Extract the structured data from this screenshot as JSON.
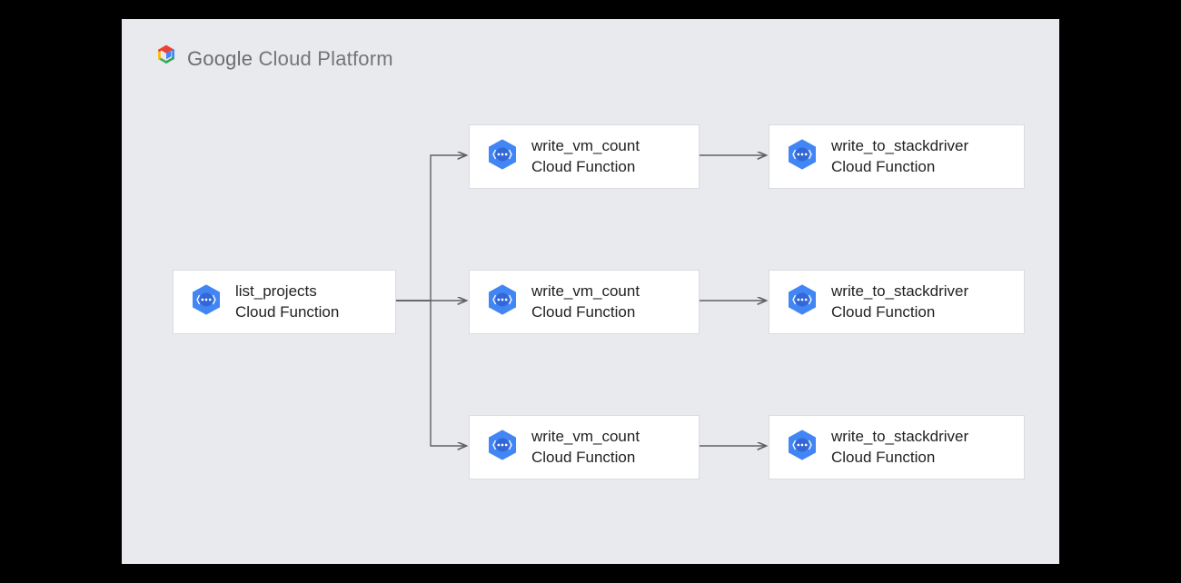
{
  "header": {
    "brand_bold": "Google",
    "brand_rest": "Cloud Platform"
  },
  "nodes": {
    "list_projects": {
      "title": "list_projects",
      "subtitle": "Cloud Function"
    },
    "write_vm_count_1": {
      "title": "write_vm_count",
      "subtitle": "Cloud Function"
    },
    "write_vm_count_2": {
      "title": "write_vm_count",
      "subtitle": "Cloud Function"
    },
    "write_vm_count_3": {
      "title": "write_vm_count",
      "subtitle": "Cloud Function"
    },
    "write_sd_1": {
      "title": "write_to_stackdriver",
      "subtitle": "Cloud Function"
    },
    "write_sd_2": {
      "title": "write_to_stackdriver",
      "subtitle": "Cloud Function"
    },
    "write_sd_3": {
      "title": "write_to_stackdriver",
      "subtitle": "Cloud Function"
    }
  },
  "colors": {
    "icon_blue": "#4285f4",
    "arrow": "#616161"
  }
}
